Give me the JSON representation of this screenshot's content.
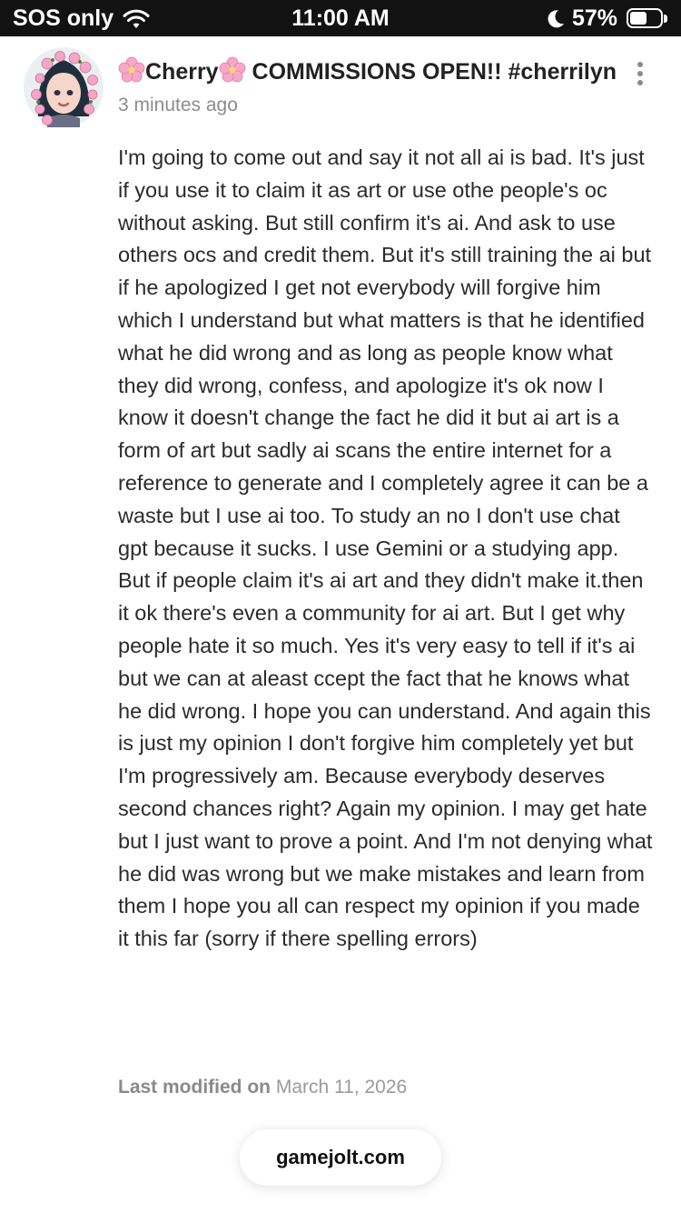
{
  "status_bar": {
    "carrier": "SOS only",
    "time": "11:00 AM",
    "battery_percent": "57%",
    "battery_level": 0.57,
    "icons": [
      "wifi-icon",
      "moon-icon",
      "battery-icon"
    ]
  },
  "post": {
    "author_title": "Cherry COMMISSIONS OPEN!! #cherrilyn",
    "author_icons": [
      "cherry-blossom-icon",
      "cherry-blossom-icon"
    ],
    "timestamp": "3 minutes ago",
    "body": "I'm going to come out and say it not all ai is bad. It's just if you use it to claim it as art or use othe people's oc without asking. But still confirm it's ai. And ask to use others ocs and credit them. But it's still training the ai but if he apologized I get not everybody will forgive him which I understand but what matters is that he identified what he did wrong and as long as people know what they did wrong, confess, and apologize it's ok now I know it doesn't change the fact he did it but ai art is a form of art but sadly ai scans the entire internet for a reference to generate and I completely agree it can be a waste but I use ai too. To study an no I don't use chat gpt because it sucks. I use Gemini or a studying app. But if people claim it's ai art and they didn't make it.then it ok there's even a community for ai art. But I get why people hate it so much. Yes it's very easy to tell if it's ai but we can at aleast ccept the fact that he knows what he did wrong. I hope you can understand. And again this is just my opinion I don't forgive him completely yet but I'm progressively am. Because everybody deserves second chances right? Again my opinion. I may get hate but I just want to prove a point. And I'm not denying what he did was wrong but we make mistakes and learn from them I hope you all can respect my opinion if you made it this far (sorry if there spelling errors)",
    "modified_label": "Last modified on",
    "modified_date": "March 11, 2026"
  },
  "browser": {
    "url": "gamejolt.com"
  },
  "colors": {
    "status_bar_bg": "#121212",
    "text": "#2b2b2b",
    "muted": "#8c8c8c",
    "blossom": "#f4a6c8"
  }
}
